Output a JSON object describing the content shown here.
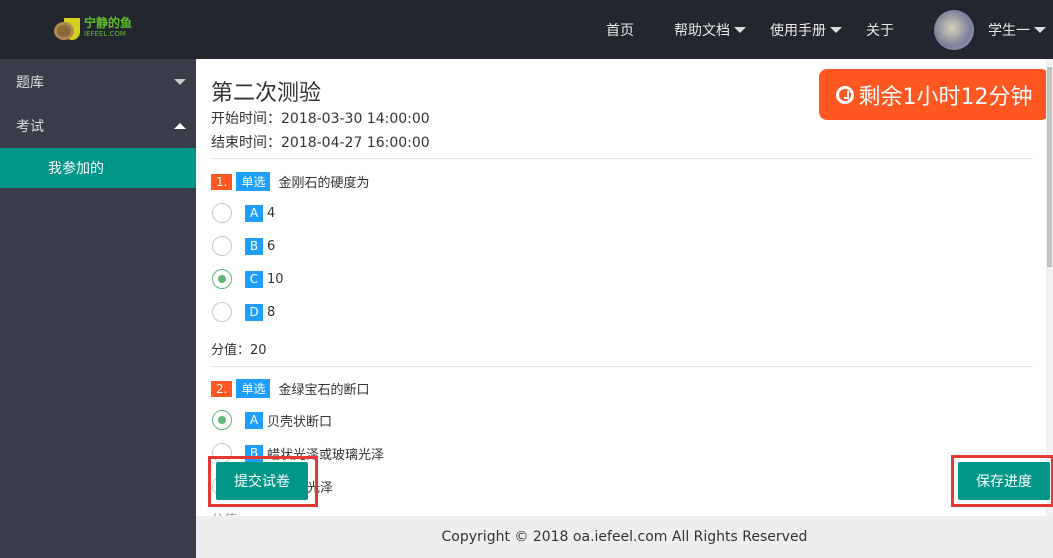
{
  "header": {
    "logo_cn": "宁静的鱼",
    "logo_en": "IEFEEL.COM",
    "nav": [
      "首页",
      "帮助文档",
      "使用手册",
      "关于"
    ],
    "user": "学生一"
  },
  "sidebar": {
    "items": [
      {
        "label": "题库",
        "expanded": false
      },
      {
        "label": "考试",
        "expanded": true
      }
    ],
    "sub": "我参加的"
  },
  "exam": {
    "title": "第二次测验",
    "start": "开始时间：2018-03-30 14:00:00",
    "end": "结束时间：2018-04-27 16:00:00",
    "timer": "剩余1小时12分钟"
  },
  "questions": [
    {
      "num": "1.",
      "type": "单选",
      "text": "金刚石的硬度为",
      "options": [
        {
          "l": "A",
          "t": "4"
        },
        {
          "l": "B",
          "t": "6"
        },
        {
          "l": "C",
          "t": "10",
          "selected": true
        },
        {
          "l": "D",
          "t": "8"
        }
      ],
      "score": "分值：20"
    },
    {
      "num": "2.",
      "type": "单选",
      "text": "金绿宝石的断口",
      "options": [
        {
          "l": "A",
          "t": "贝壳状断口",
          "selected": true
        },
        {
          "l": "B",
          "t": "蜡状光泽或玻璃光泽"
        },
        {
          "l": "C",
          "t": "光泽"
        }
      ],
      "score": "分值"
    }
  ],
  "buttons": {
    "submit": "提交试卷",
    "save": "保存进度"
  },
  "footer": "Copyright © 2018 oa.iefeel.com All Rights Reserved",
  "colors": {
    "topbar": "#23262e",
    "sidebar": "#393d49",
    "accent": "#009688",
    "timer": "#ff5722",
    "tag": "#1e9fff"
  }
}
